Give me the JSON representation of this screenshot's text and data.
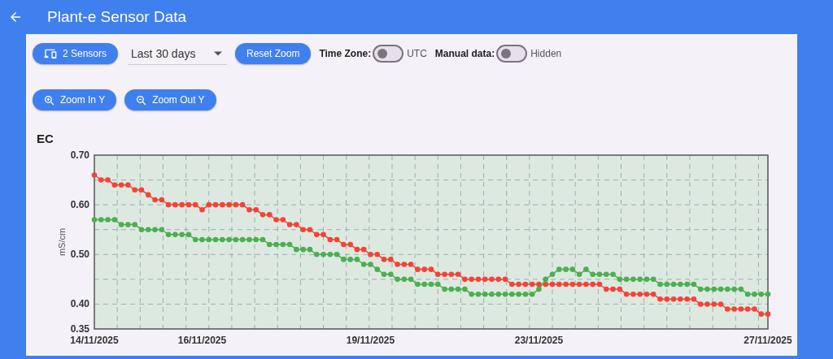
{
  "app_bar": {
    "title": "Plant-e Sensor Data"
  },
  "toolbar": {
    "sensors_button": "2 Sensors",
    "range_select": {
      "value": "Last 30 days"
    },
    "reset_button": "Reset Zoom",
    "toggles": [
      {
        "label": "Time Zone:",
        "on": false,
        "state_text": "UTC"
      },
      {
        "label": "Manual data:",
        "on": false,
        "state_text": "Hidden"
      }
    ]
  },
  "zoom_buttons": [
    {
      "kind": "in",
      "label": "Zoom In Y"
    },
    {
      "kind": "out",
      "label": "Zoom Out Y"
    }
  ],
  "chart": {
    "title": "EC",
    "chart_data": {
      "type": "line",
      "ylabel": "mS/cm",
      "categories": [
        "14/11/2025",
        null,
        null,
        null,
        null,
        null,
        null,
        null,
        null,
        null,
        null,
        null,
        null,
        null,
        null,
        null,
        "16/11/2025",
        null,
        null,
        null,
        null,
        null,
        null,
        null,
        null,
        null,
        null,
        null,
        null,
        null,
        null,
        null,
        null,
        null,
        null,
        null,
        null,
        null,
        null,
        null,
        null,
        "19/11/2025",
        null,
        null,
        null,
        null,
        null,
        null,
        null,
        null,
        null,
        null,
        null,
        null,
        null,
        null,
        null,
        null,
        null,
        null,
        null,
        null,
        null,
        null,
        null,
        null,
        "23/11/2025",
        null,
        null,
        null,
        null,
        null,
        null,
        null,
        null,
        null,
        null,
        null,
        null,
        null,
        null,
        null,
        null,
        null,
        null,
        null,
        null,
        null,
        null,
        null,
        null,
        null,
        null,
        null,
        null,
        null,
        null,
        null,
        null,
        null,
        "27/11/2025"
      ],
      "series": [
        {
          "color": "#f44336",
          "marker": "circle",
          "values": [
            0.66,
            0.65,
            0.65,
            0.64,
            0.64,
            0.64,
            0.63,
            0.63,
            0.62,
            0.61,
            0.61,
            0.6,
            0.6,
            0.6,
            0.6,
            0.6,
            0.59,
            0.6,
            0.6,
            0.6,
            0.6,
            0.6,
            0.6,
            0.59,
            0.59,
            0.58,
            0.58,
            0.57,
            0.57,
            0.56,
            0.56,
            0.55,
            0.55,
            0.54,
            0.54,
            0.53,
            0.53,
            0.52,
            0.52,
            0.51,
            0.51,
            0.5,
            0.5,
            0.49,
            0.49,
            0.48,
            0.48,
            0.48,
            0.47,
            0.47,
            0.47,
            0.46,
            0.46,
            0.46,
            0.46,
            0.45,
            0.45,
            0.45,
            0.45,
            0.45,
            0.45,
            0.45,
            0.44,
            0.44,
            0.44,
            0.44,
            0.44,
            0.44,
            0.44,
            0.44,
            0.44,
            0.44,
            0.44,
            0.44,
            0.44,
            0.44,
            0.43,
            0.43,
            0.43,
            0.42,
            0.42,
            0.42,
            0.42,
            0.42,
            0.41,
            0.41,
            0.41,
            0.41,
            0.41,
            0.41,
            0.4,
            0.4,
            0.4,
            0.4,
            0.39,
            0.39,
            0.39,
            0.39,
            0.39,
            0.38,
            0.38
          ]
        },
        {
          "color": "#4caf50",
          "marker": "circle",
          "values": [
            0.57,
            0.57,
            0.57,
            0.57,
            0.56,
            0.56,
            0.56,
            0.55,
            0.55,
            0.55,
            0.55,
            0.54,
            0.54,
            0.54,
            0.54,
            0.53,
            0.53,
            0.53,
            0.53,
            0.53,
            0.53,
            0.53,
            0.53,
            0.53,
            0.53,
            0.53,
            0.52,
            0.52,
            0.52,
            0.52,
            0.51,
            0.51,
            0.51,
            0.5,
            0.5,
            0.5,
            0.5,
            0.49,
            0.49,
            0.49,
            0.48,
            0.48,
            0.47,
            0.46,
            0.46,
            0.45,
            0.45,
            0.45,
            0.44,
            0.44,
            0.44,
            0.44,
            0.43,
            0.43,
            0.43,
            0.43,
            0.42,
            0.42,
            0.42,
            0.42,
            0.42,
            0.42,
            0.42,
            0.42,
            0.42,
            0.42,
            0.43,
            0.45,
            0.46,
            0.47,
            0.47,
            0.47,
            0.46,
            0.47,
            0.46,
            0.46,
            0.46,
            0.46,
            0.45,
            0.45,
            0.45,
            0.45,
            0.45,
            0.45,
            0.44,
            0.44,
            0.44,
            0.44,
            0.44,
            0.44,
            0.43,
            0.43,
            0.43,
            0.43,
            0.43,
            0.43,
            0.43,
            0.42,
            0.42,
            0.42,
            0.42
          ]
        }
      ],
      "ylim": [
        0.35,
        0.7
      ],
      "grid": true,
      "yticks": [
        {
          "value": 0.35,
          "label": "0.35"
        },
        {
          "value": 0.4,
          "label": "0.40"
        },
        {
          "value": 0.5,
          "label": "0.50"
        },
        {
          "value": 0.6,
          "label": "0.60"
        },
        {
          "value": 0.7,
          "label": "0.70"
        }
      ]
    }
  }
}
